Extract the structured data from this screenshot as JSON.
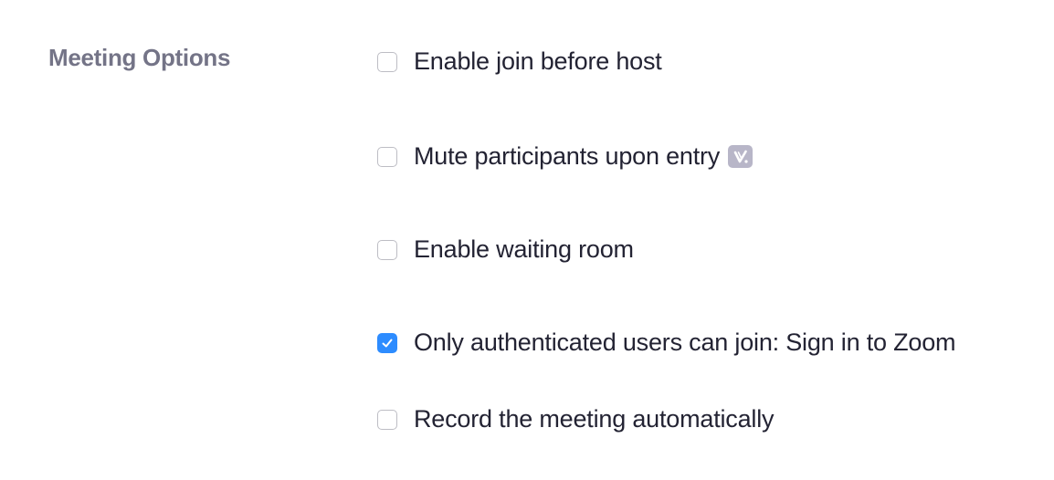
{
  "meeting_options": {
    "section_label": "Meeting Options",
    "options": [
      {
        "label": "Enable join before host",
        "checked": false
      },
      {
        "label": "Mute participants upon entry",
        "checked": false,
        "badge_icon": "version-v-icon"
      },
      {
        "label": "Enable waiting room",
        "checked": false
      },
      {
        "label": "Only authenticated users can join: Sign in to Zoom",
        "checked": true
      },
      {
        "label": "Record the meeting automatically",
        "checked": false
      }
    ]
  },
  "colors": {
    "checkbox_checked": "#2d8cff",
    "section_label": "#747487",
    "option_text": "#232333",
    "badge": "#b8b6c8"
  }
}
